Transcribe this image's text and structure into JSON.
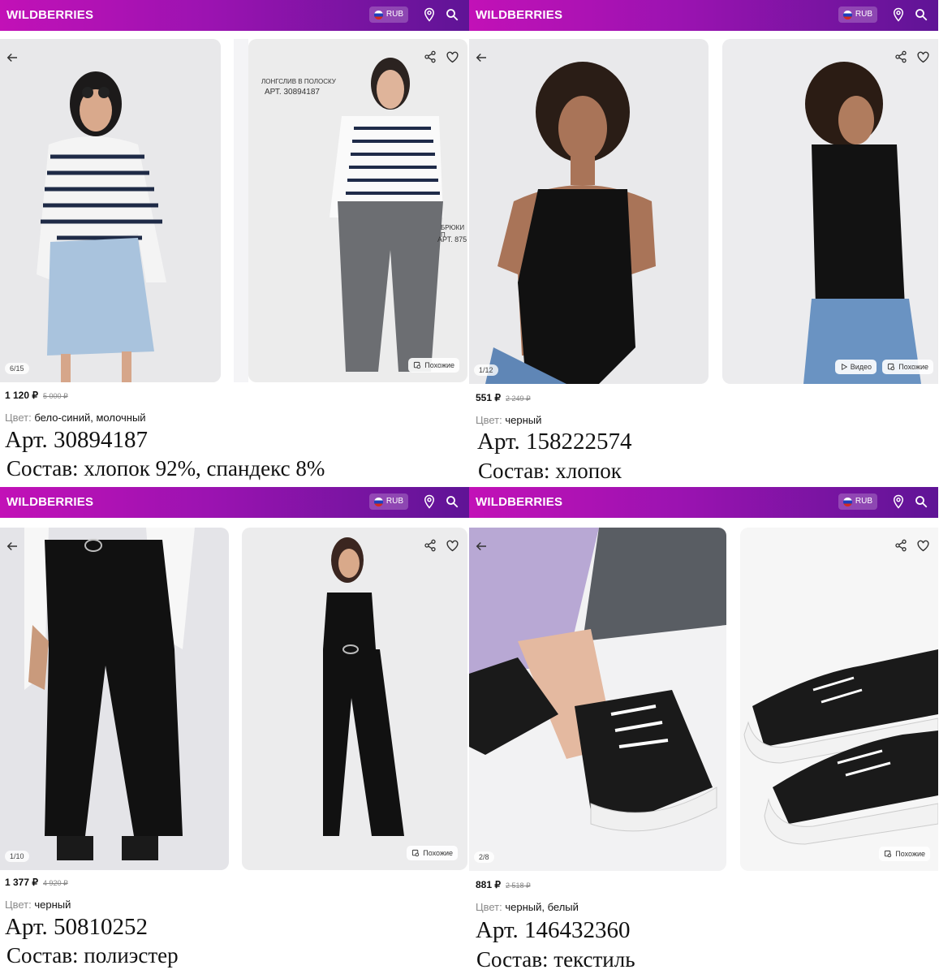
{
  "header": {
    "logo": "WILDBERRIES",
    "currency": "RUB"
  },
  "products": [
    {
      "counter": "6/15",
      "price": "1 120 ₽",
      "old_price": "5 000 ₽",
      "color_label": "Цвет:",
      "color": "бело-синий, молочный",
      "article": "Арт. 30894187",
      "composition": "Состав: хлопок 92%, спандекс 8%",
      "similar": "Похожие",
      "annotation1": "ЛОНГСЛИВ В ПОЛОСКУ",
      "annotation2": "АРТ. 30894187",
      "annotation3": "БРЮКИ П",
      "annotation4": "АРТ. 875"
    },
    {
      "counter": "1/12",
      "price": "551 ₽",
      "old_price": "2 249 ₽",
      "color_label": "Цвет:",
      "color": "черный",
      "article": "Арт. 158222574",
      "composition": "Состав: хлопок",
      "video": "Видео",
      "similar": "Похожие"
    },
    {
      "counter": "1/10",
      "price": "1 377 ₽",
      "old_price": "4 920 ₽",
      "color_label": "Цвет:",
      "color": "черный",
      "article": "Арт. 50810252",
      "composition": "Состав: полиэстер",
      "similar": "Похожие"
    },
    {
      "counter": "2/8",
      "price": "881 ₽",
      "old_price": "2 518 ₽",
      "color_label": "Цвет:",
      "color": "черный, белый",
      "article": "Арт. 146432360",
      "composition": "Состав: текстиль",
      "similar": "Похожие"
    }
  ],
  "colors": {
    "header_start": "#c211b7",
    "header_end": "#5f1496"
  }
}
